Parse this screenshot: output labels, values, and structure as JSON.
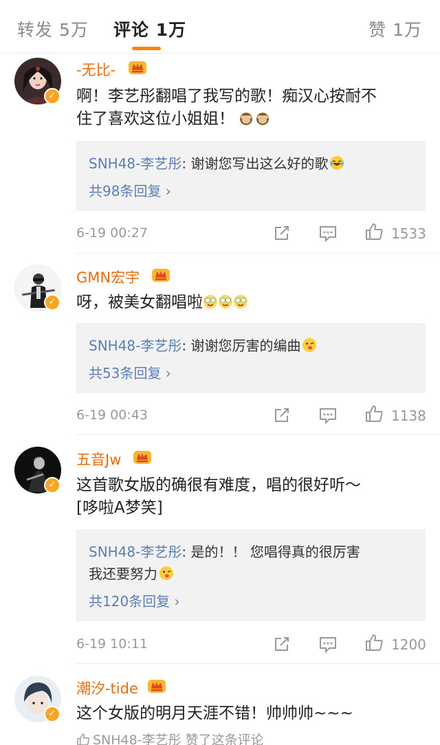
{
  "tabs": {
    "repost": "转发 5万",
    "comments": "评论 1万",
    "likes": "赞 1万"
  },
  "colors": {
    "accent": "#ff8200",
    "username": "#e86b0c",
    "link": "#5b7fb5",
    "verified_badge": "#f6a623"
  },
  "comments": [
    {
      "username": "-无比-",
      "text": "啊！李艺彤翻唱了我写的歌！痴汉心按耐不\n住了喜欢这位小姐姐！",
      "text_emoji": "see-no-evil-monkey-emoji x2",
      "reply": {
        "author": "SNH48-李艺彤",
        "text": ": 谢谢您写出这么好的歌",
        "emoji": "laugh-tears-emoji"
      },
      "reply_count": "共98条回复 ›",
      "time": "6-19 00:27",
      "likes": "1533"
    },
    {
      "username": "GMN宏宇",
      "text": "呀，被美女翻唱啦",
      "text_emoji": "drool-emoji x3",
      "reply": {
        "author": "SNH48-李艺彤",
        "text": ": 谢谢您厉害的编曲",
        "emoji": "wink-tongue-emoji"
      },
      "reply_count": "共53条回复 ›",
      "time": "6-19 00:43",
      "likes": "1138"
    },
    {
      "username": "五音Jw",
      "text": "这首歌女版的确很有难度，唱的很好听～\n[哆啦A梦笑]",
      "reply": {
        "author": "SNH48-李艺彤",
        "text": ": 是的！！ 您唱得真的很厉害",
        "text2": "我还要努力",
        "emoji": "wink-tongue-emoji"
      },
      "reply_count": "共120条回复 ›",
      "time": "6-19 10:11",
      "likes": "1200"
    },
    {
      "username": "潮汐-tide",
      "text": "这个女版的明月天涯不错！帅帅帅~~~",
      "liked_by": "SNH48-李艺彤 赞了这条评论"
    }
  ]
}
